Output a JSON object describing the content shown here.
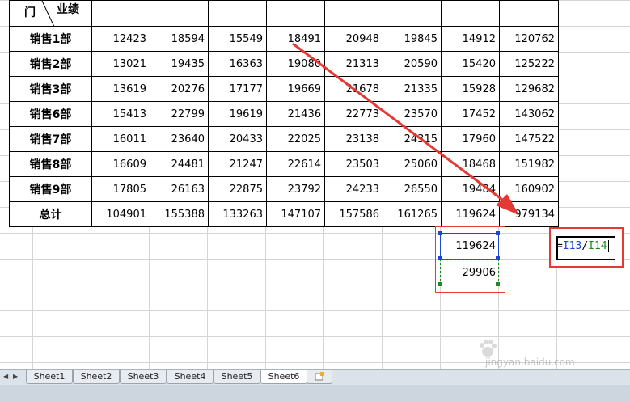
{
  "table": {
    "header_left": "门",
    "header_diag": "业绩",
    "rows": [
      {
        "label": "销售1部",
        "values": [
          "12423",
          "18594",
          "15549",
          "18491",
          "20948",
          "19845",
          "14912",
          "120762"
        ]
      },
      {
        "label": "销售2部",
        "values": [
          "13021",
          "19435",
          "16363",
          "19080",
          "21313",
          "20590",
          "15420",
          "125222"
        ]
      },
      {
        "label": "销售3部",
        "values": [
          "13619",
          "20276",
          "17177",
          "19669",
          "21678",
          "21335",
          "15928",
          "129682"
        ]
      },
      {
        "label": "销售6部",
        "values": [
          "15413",
          "22799",
          "19619",
          "21436",
          "22773",
          "23570",
          "17452",
          "143062"
        ]
      },
      {
        "label": "销售7部",
        "values": [
          "16011",
          "23640",
          "20433",
          "22025",
          "23138",
          "24315",
          "17960",
          "147522"
        ]
      },
      {
        "label": "销售8部",
        "values": [
          "16609",
          "24481",
          "21247",
          "22614",
          "23503",
          "25060",
          "18468",
          "151982"
        ]
      },
      {
        "label": "销售9部",
        "values": [
          "17805",
          "26163",
          "22875",
          "23792",
          "24233",
          "26550",
          "19484",
          "160902"
        ]
      },
      {
        "label": "总计",
        "values": [
          "104901",
          "155388",
          "133263",
          "147107",
          "157586",
          "161265",
          "119624",
          "979134"
        ]
      }
    ]
  },
  "cells": {
    "i13": "119624",
    "i14": "29906"
  },
  "editor": {
    "eq": "=",
    "ref1": "I13",
    "slash": "/",
    "ref2": "I14"
  },
  "tabs": [
    "Sheet1",
    "Sheet2",
    "Sheet3",
    "Sheet4",
    "Sheet5",
    "Sheet6"
  ],
  "active_tab": "Sheet6",
  "watermark": {
    "logo": "Bai 经验",
    "url": "jingyan.baidu.com"
  },
  "colors": {
    "highlight": "#e53935",
    "ref_blue": "#1f46d6",
    "ref_green": "#1c8a1c"
  }
}
